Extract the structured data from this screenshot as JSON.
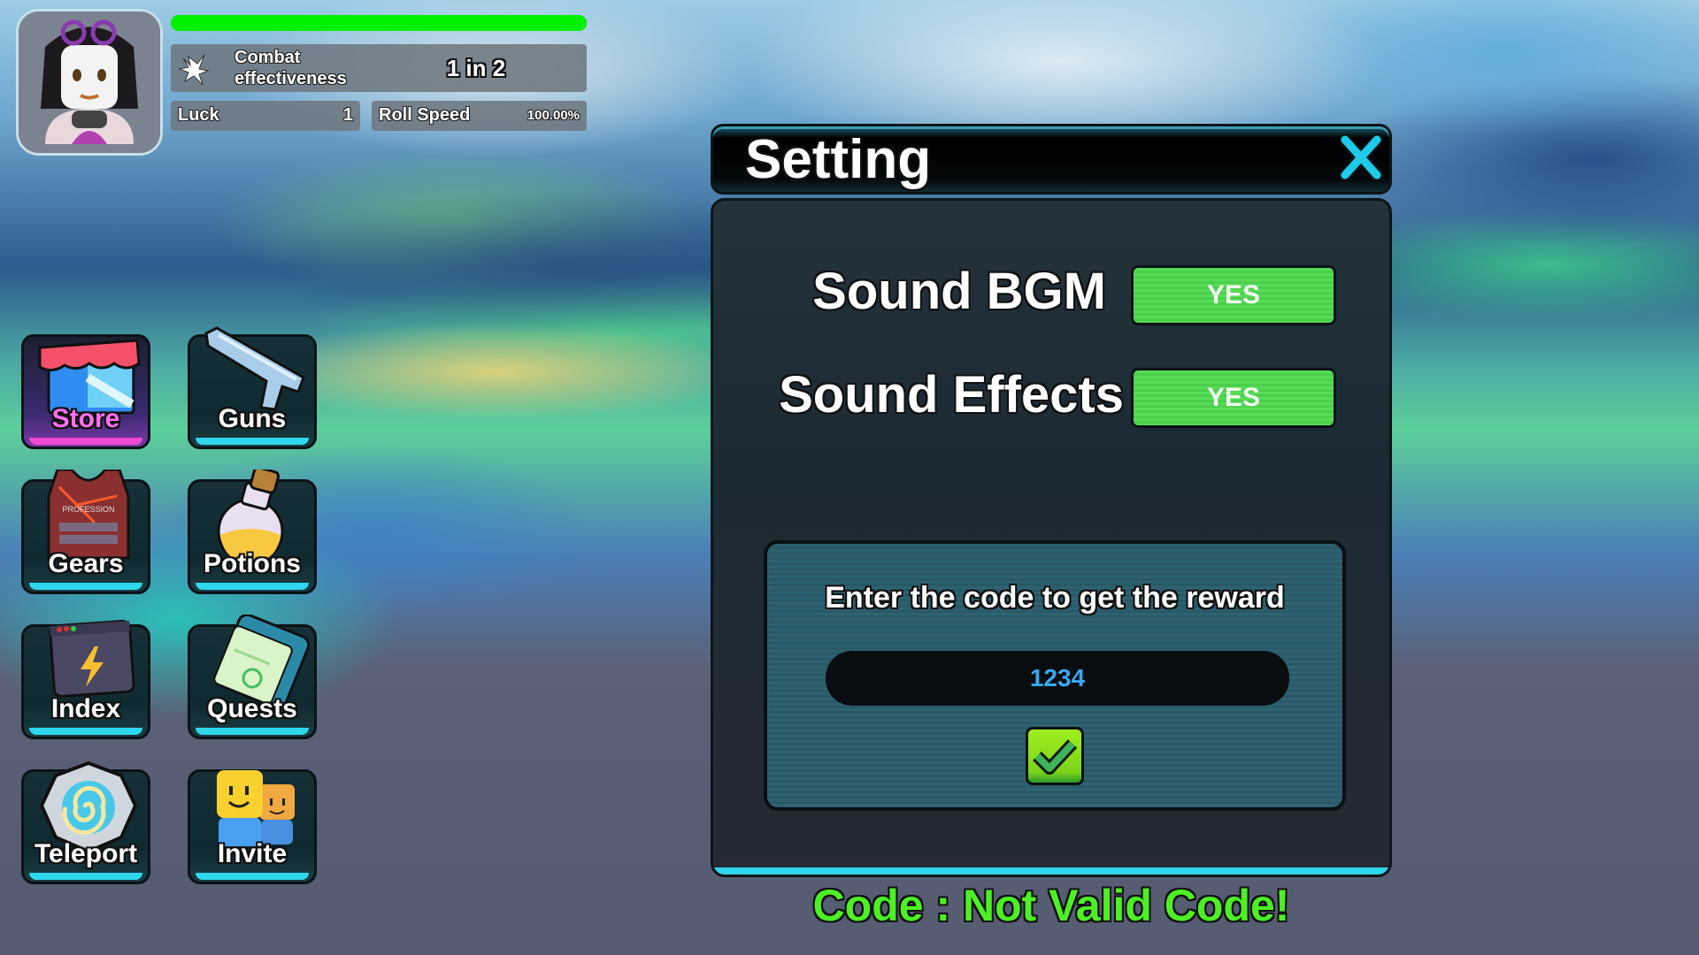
{
  "hud": {
    "avatar_alt": "player-avatar",
    "health_fraction": 1.0,
    "combat": {
      "label_line1": "Combat",
      "label_line2": "effectiveness",
      "value": "1 in 2"
    },
    "luck": {
      "label": "Luck",
      "value": "1"
    },
    "roll_speed": {
      "label": "Roll Speed",
      "value": "100.00%"
    }
  },
  "menu": {
    "items": [
      {
        "id": "store",
        "label": "Store",
        "icon": "store-icon"
      },
      {
        "id": "guns",
        "label": "Guns",
        "icon": "gun-icon"
      },
      {
        "id": "gears",
        "label": "Gears",
        "icon": "vest-icon",
        "icon_text": "PROFESSION"
      },
      {
        "id": "potions",
        "label": "Potions",
        "icon": "potion-icon"
      },
      {
        "id": "index",
        "label": "Index",
        "icon": "index-window-icon"
      },
      {
        "id": "quests",
        "label": "Quests",
        "icon": "quest-clipboard-icon"
      },
      {
        "id": "teleport",
        "label": "Teleport",
        "icon": "portal-icon"
      },
      {
        "id": "invite",
        "label": "Invite",
        "icon": "friends-icon"
      }
    ]
  },
  "settings": {
    "title": "Setting",
    "close_icon": "close-icon",
    "rows": [
      {
        "label": "Sound BGM",
        "value": "YES"
      },
      {
        "label": "Sound Effects",
        "value": "YES"
      }
    ],
    "code": {
      "prompt": "Enter the code to get the reward",
      "value": "1234",
      "submit_icon": "checkmark-icon"
    },
    "status": "Code : Not Valid Code!"
  },
  "colors": {
    "health": "#00f000",
    "accent_cyan": "#2fd7ec",
    "yes_green": "#4ccf4c",
    "status_green": "#4cf024",
    "code_text": "#3aa8f0",
    "store_pink": "#ff6ff0"
  }
}
